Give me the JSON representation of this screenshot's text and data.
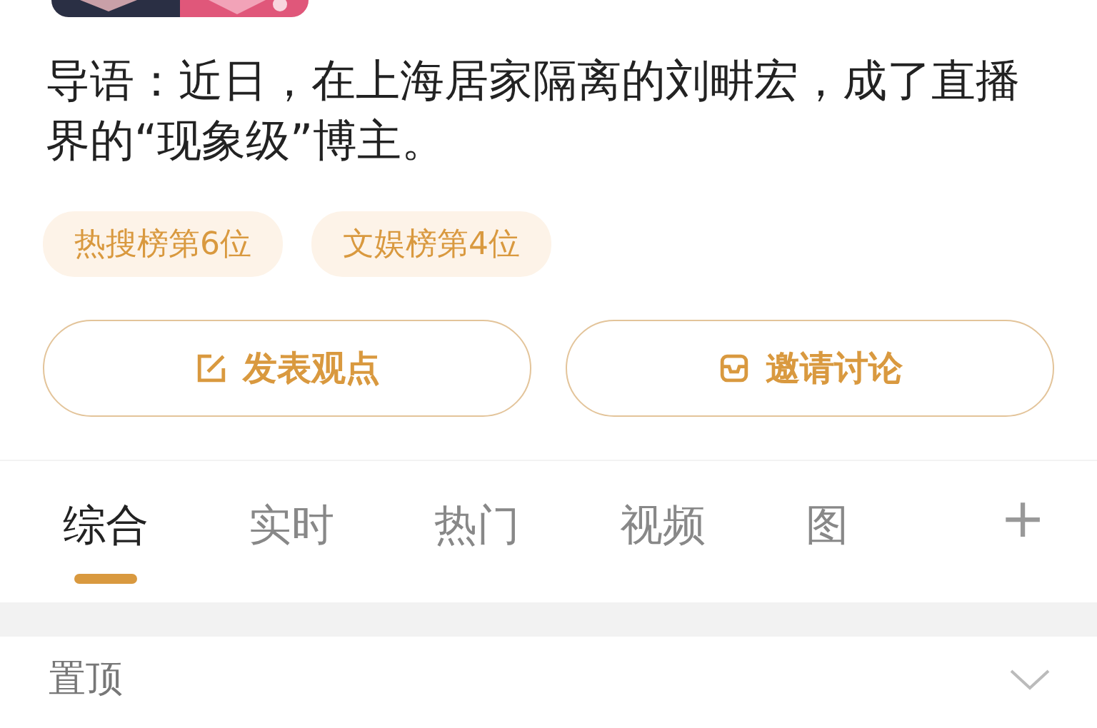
{
  "intro": "导语：近日，在上海居家隔离的刘畊宏，成了直播界的“现象级”博主。",
  "badges": [
    "热搜榜第6位",
    "文娱榜第4位"
  ],
  "actions": [
    {
      "label": "发表观点",
      "kind": "edit"
    },
    {
      "label": "邀请讨论",
      "kind": "invite"
    }
  ],
  "tabs": [
    {
      "label": "综合",
      "selected": true
    },
    {
      "label": "实时",
      "selected": false
    },
    {
      "label": "热门",
      "selected": false
    },
    {
      "label": "视频",
      "selected": false
    },
    {
      "label": "图",
      "selected": false
    }
  ],
  "add_tab": "+",
  "pinned": {
    "label": "置顶",
    "expanded": false
  }
}
